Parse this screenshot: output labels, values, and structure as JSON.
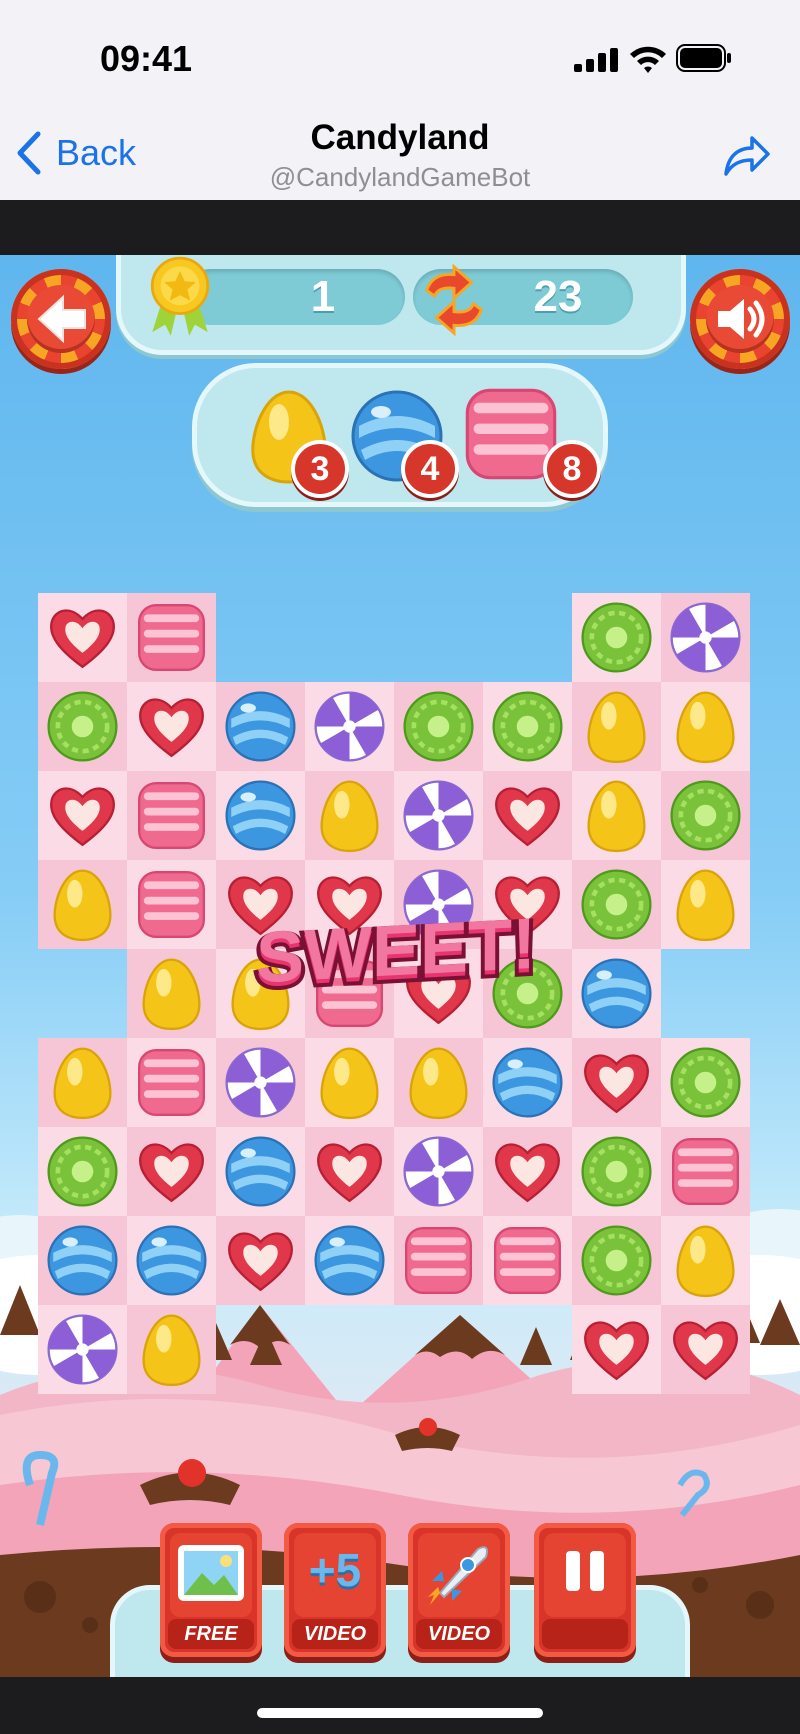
{
  "status_bar": {
    "time": "09:41"
  },
  "nav": {
    "back_label": "Back",
    "title": "Candyland",
    "subtitle": "@CandylandGameBot"
  },
  "hud": {
    "level": "1",
    "moves": "23"
  },
  "goals": [
    {
      "candy": "yellow-drop",
      "count": "3"
    },
    {
      "candy": "blue-ball",
      "count": "4"
    },
    {
      "candy": "pink-cube",
      "count": "8"
    }
  ],
  "board": {
    "cols": 8,
    "rows": 9,
    "legend": {
      "H": "heart",
      "P": "pink-cube",
      "G": "green-swirl",
      "S": "purple-swirl",
      "B": "blue-ball",
      "Y": "yellow-drop",
      ".": "empty"
    },
    "grid": [
      "HP....GS",
      "GHBSGGYY",
      "HPBYSHYG",
      "YPHHSHGY",
      ".YYPHGB.",
      "YPSYYBHG",
      "GHBHSHGP",
      "BBHBPPGY",
      "SY....HH"
    ]
  },
  "popup": {
    "text": "SWEET!"
  },
  "boosters": [
    {
      "name": "picture",
      "tag": "FREE"
    },
    {
      "name": "plus-five",
      "label": "+5",
      "tag": "VIDEO"
    },
    {
      "name": "rocket",
      "tag": "VIDEO"
    },
    {
      "name": "pause",
      "tag": ""
    }
  ]
}
